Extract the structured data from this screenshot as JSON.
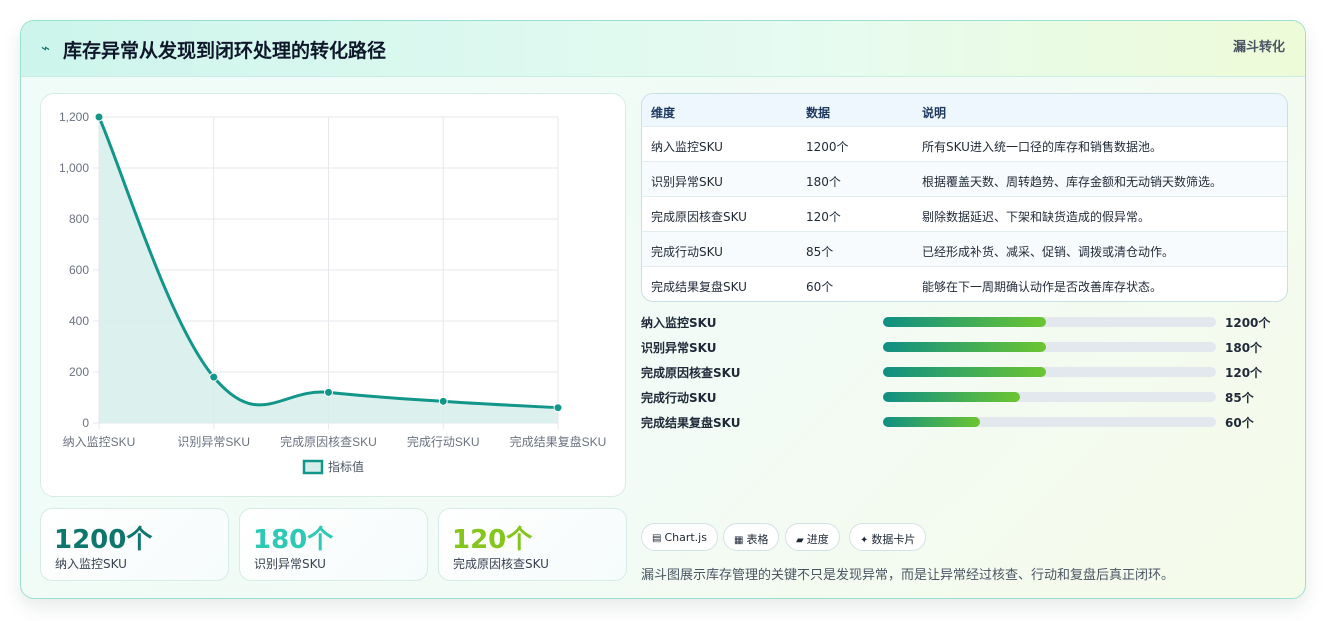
{
  "header": {
    "icon": "lightning-icon",
    "title": "库存异常从发现到闭环处理的转化路径",
    "tag": "漏斗转化"
  },
  "chart_data": {
    "type": "line",
    "categories": [
      "纳入监控SKU",
      "识别异常SKU",
      "完成原因核查SKU",
      "完成行动SKU",
      "完成结果复盘SKU"
    ],
    "series": [
      {
        "name": "指标值",
        "values": [
          1200,
          180,
          120,
          85,
          60
        ]
      }
    ],
    "ylim": [
      0,
      1200
    ],
    "yticks": [
      "0",
      "200",
      "400",
      "600",
      "800",
      "1,000",
      "1,200"
    ],
    "area_fill": true,
    "grid": true,
    "legend": "bottom",
    "colors": {
      "line": "#12968a",
      "fill": "#d6eeea"
    }
  },
  "kpis": [
    {
      "value": "1200个",
      "label": "纳入监控SKU",
      "color": "#0f766e"
    },
    {
      "value": "180个",
      "label": "识别异常SKU",
      "color": "#2dc9b4"
    },
    {
      "value": "120个",
      "label": "完成原因核查SKU",
      "color": "#84c61b"
    }
  ],
  "table": {
    "headers": [
      "维度",
      "数据",
      "说明"
    ],
    "rows": [
      [
        "纳入监控SKU",
        "1200个",
        "所有SKU进入统一口径的库存和销售数据池。"
      ],
      [
        "识别异常SKU",
        "180个",
        "根据覆盖天数、周转趋势、库存金额和无动销天数筛选。"
      ],
      [
        "完成原因核查SKU",
        "120个",
        "剔除数据延迟、下架和缺货造成的假异常。"
      ],
      [
        "完成行动SKU",
        "85个",
        "已经形成补货、减采、促销、调拨或清仓动作。"
      ],
      [
        "完成结果复盘SKU",
        "60个",
        "能够在下一周期确认动作是否改善库存状态。"
      ]
    ]
  },
  "progress": [
    {
      "label": "纳入监控SKU",
      "value": "1200个",
      "fraction": 0.49
    },
    {
      "label": "识别异常SKU",
      "value": "180个",
      "fraction": 0.49
    },
    {
      "label": "完成原因核查SKU",
      "value": "120个",
      "fraction": 0.49
    },
    {
      "label": "完成行动SKU",
      "value": "85个",
      "fraction": 0.41
    },
    {
      "label": "完成结果复盘SKU",
      "value": "60个",
      "fraction": 0.29
    }
  ],
  "chips": [
    {
      "icon": "chart-icon",
      "glyph": "▤",
      "label": "Chart.js"
    },
    {
      "icon": "table-icon",
      "glyph": "▦",
      "label": "表格"
    },
    {
      "icon": "progress-icon",
      "glyph": "▰",
      "label": "进度"
    },
    {
      "icon": "card-icon",
      "glyph": "✦",
      "label": "数据卡片"
    }
  ],
  "note": "漏斗图展示库存管理的关键不只是发现异常，而是让异常经过核查、行动和复盘后真正闭环。"
}
